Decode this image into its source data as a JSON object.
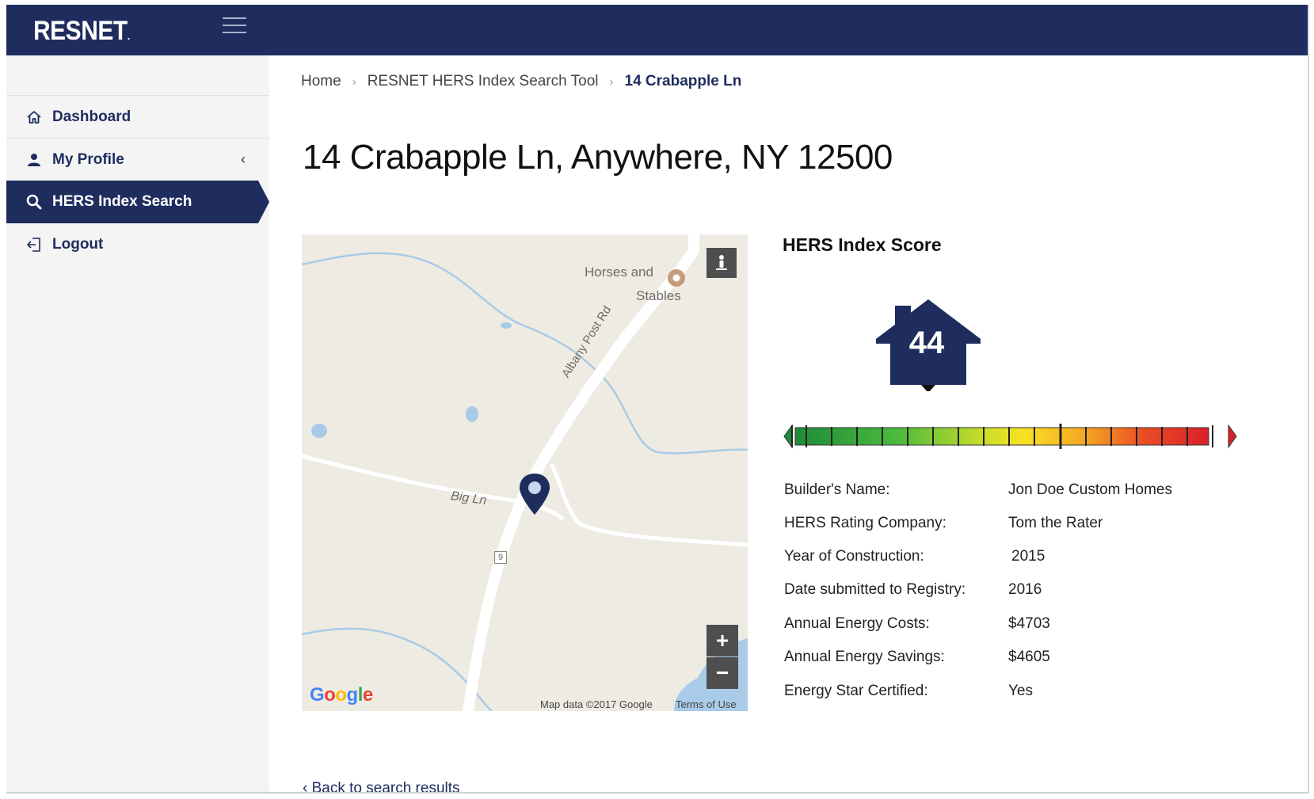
{
  "header": {
    "logo": "RESNET",
    "logo_mark": "."
  },
  "sidebar": {
    "items": [
      {
        "label": "Dashboard",
        "icon": "home-icon"
      },
      {
        "label": "My Profile",
        "icon": "user-icon",
        "chevron": "‹"
      },
      {
        "label": "HERS Index Search",
        "icon": "search-icon",
        "active": true
      },
      {
        "label": "Logout",
        "icon": "logout-icon"
      }
    ]
  },
  "breadcrumb": {
    "home": "Home",
    "tool": "RESNET HERS Index Search Tool",
    "current": "14 Crabapple Ln",
    "separator": "›"
  },
  "page": {
    "title": "14 Crabapple Ln, Anywhere, NY 12500",
    "back_link": "‹ Back to search results"
  },
  "map": {
    "poi_line1": "Horses and",
    "poi_line2": "Stables",
    "road_albany": "Albany Post Rd",
    "road_big": "Big Ln",
    "route_badge": "9",
    "zoom_in": "+",
    "zoom_out": "−",
    "attribution": "Map data ©2017 Google",
    "terms": "Terms of Use",
    "brand": [
      "G",
      "o",
      "o",
      "g",
      "l",
      "e"
    ]
  },
  "hers": {
    "heading": "HERS Index Score",
    "score": "44",
    "scale_position_fraction": 0.3
  },
  "details": [
    {
      "label": "Builder's Name:",
      "value": "Jon Doe Custom Homes"
    },
    {
      "label": "HERS Rating Company:",
      "value": "Tom the Rater"
    },
    {
      "label": "Year of Construction:",
      "value": "2015"
    },
    {
      "label": "Date submitted to Registry:",
      "value": "2016"
    },
    {
      "label": "Annual Energy Costs:",
      "value": "$4703"
    },
    {
      "label": "Annual Energy Savings:",
      "value": "$4605"
    },
    {
      "label": "Energy Star Certified:",
      "value": "Yes"
    }
  ],
  "colors": {
    "navy": "#1f2d5e",
    "sidebar_bg": "#f4f4f5"
  }
}
